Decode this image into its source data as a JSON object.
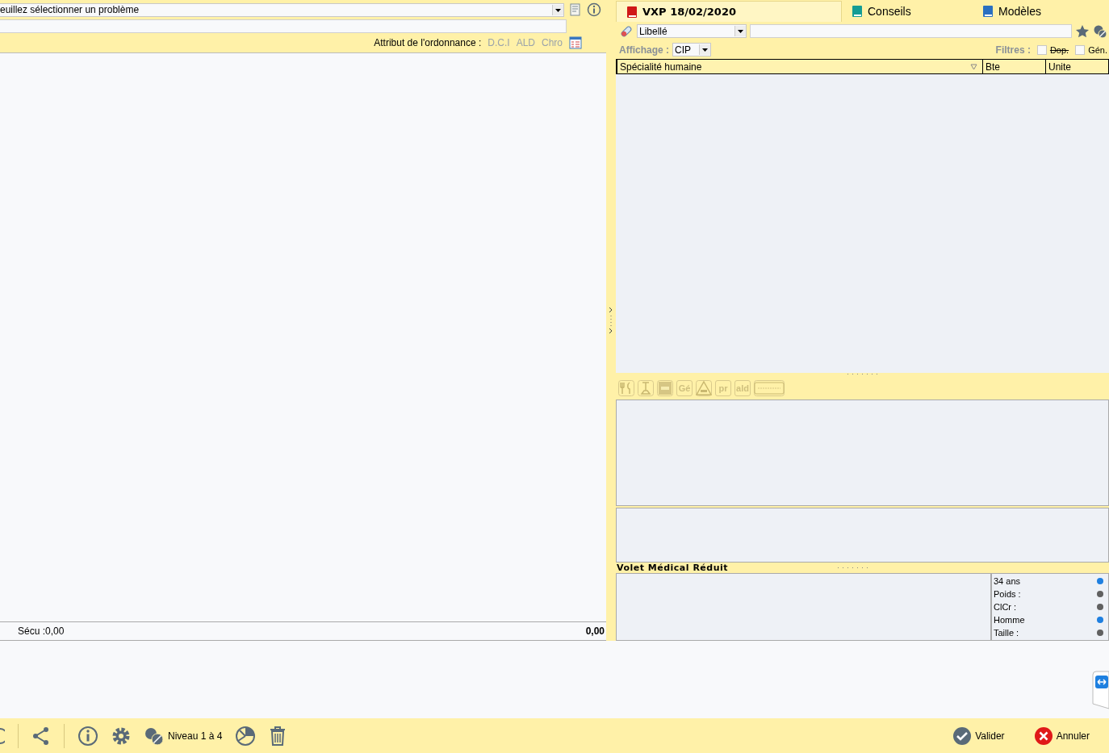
{
  "left": {
    "problem_select": {
      "value": "euillez sélectionner un problème"
    },
    "attributes": {
      "label": "Attribut de l'ordonnance :",
      "options": [
        {
          "label": "D.C.I",
          "selected": false
        },
        {
          "label": "ALD",
          "selected": false
        },
        {
          "label": "Chro",
          "selected": false
        }
      ]
    },
    "footer": {
      "secu": "Sécu :",
      "secu_value": "0,00",
      "total": "0,00"
    }
  },
  "right": {
    "tabs": [
      {
        "label": "VXP 18/02/2020",
        "selected": true,
        "color": "#d01818"
      },
      {
        "label": "Conseils",
        "selected": false,
        "color": "#149c94"
      },
      {
        "label": "Modèles",
        "selected": false,
        "color": "#2a6fc0"
      }
    ],
    "search": {
      "mode": "Libellé"
    },
    "display": {
      "label": "Affichage :",
      "value": "CIP"
    },
    "filters": {
      "label": "Filtres :",
      "items": [
        {
          "label": "Dop.",
          "checked": false,
          "struck": true
        },
        {
          "label": "Gén.",
          "checked": false,
          "struck": false
        }
      ]
    },
    "table": {
      "columns": [
        "Spécialité humaine",
        "Bte",
        "Unite"
      ]
    },
    "tools": [
      {
        "kind": "icon",
        "disabled": true
      },
      {
        "kind": "icon",
        "disabled": true
      },
      {
        "kind": "icon",
        "disabled": true
      },
      {
        "kind": "text",
        "label": "Gé",
        "disabled": true
      },
      {
        "kind": "icon",
        "disabled": true
      },
      {
        "kind": "text",
        "label": "pr",
        "disabled": true
      },
      {
        "kind": "text",
        "label": "ald",
        "disabled": true
      },
      {
        "kind": "icon",
        "disabled": true
      }
    ],
    "summary": {
      "title": "Volet Médical Réduit",
      "items": [
        {
          "label": "34 ans",
          "color": "#1e7fe0"
        },
        {
          "label": "Poids :",
          "color": "#606060"
        },
        {
          "label": "ClCr :",
          "color": "#606060"
        },
        {
          "label": "Homme",
          "color": "#1e7fe0"
        },
        {
          "label": "Taille :",
          "color": "#606060"
        }
      ]
    }
  },
  "toolbar": {
    "level": "Niveau 1 à 4",
    "validate": "Valider",
    "cancel": "Annuler"
  }
}
